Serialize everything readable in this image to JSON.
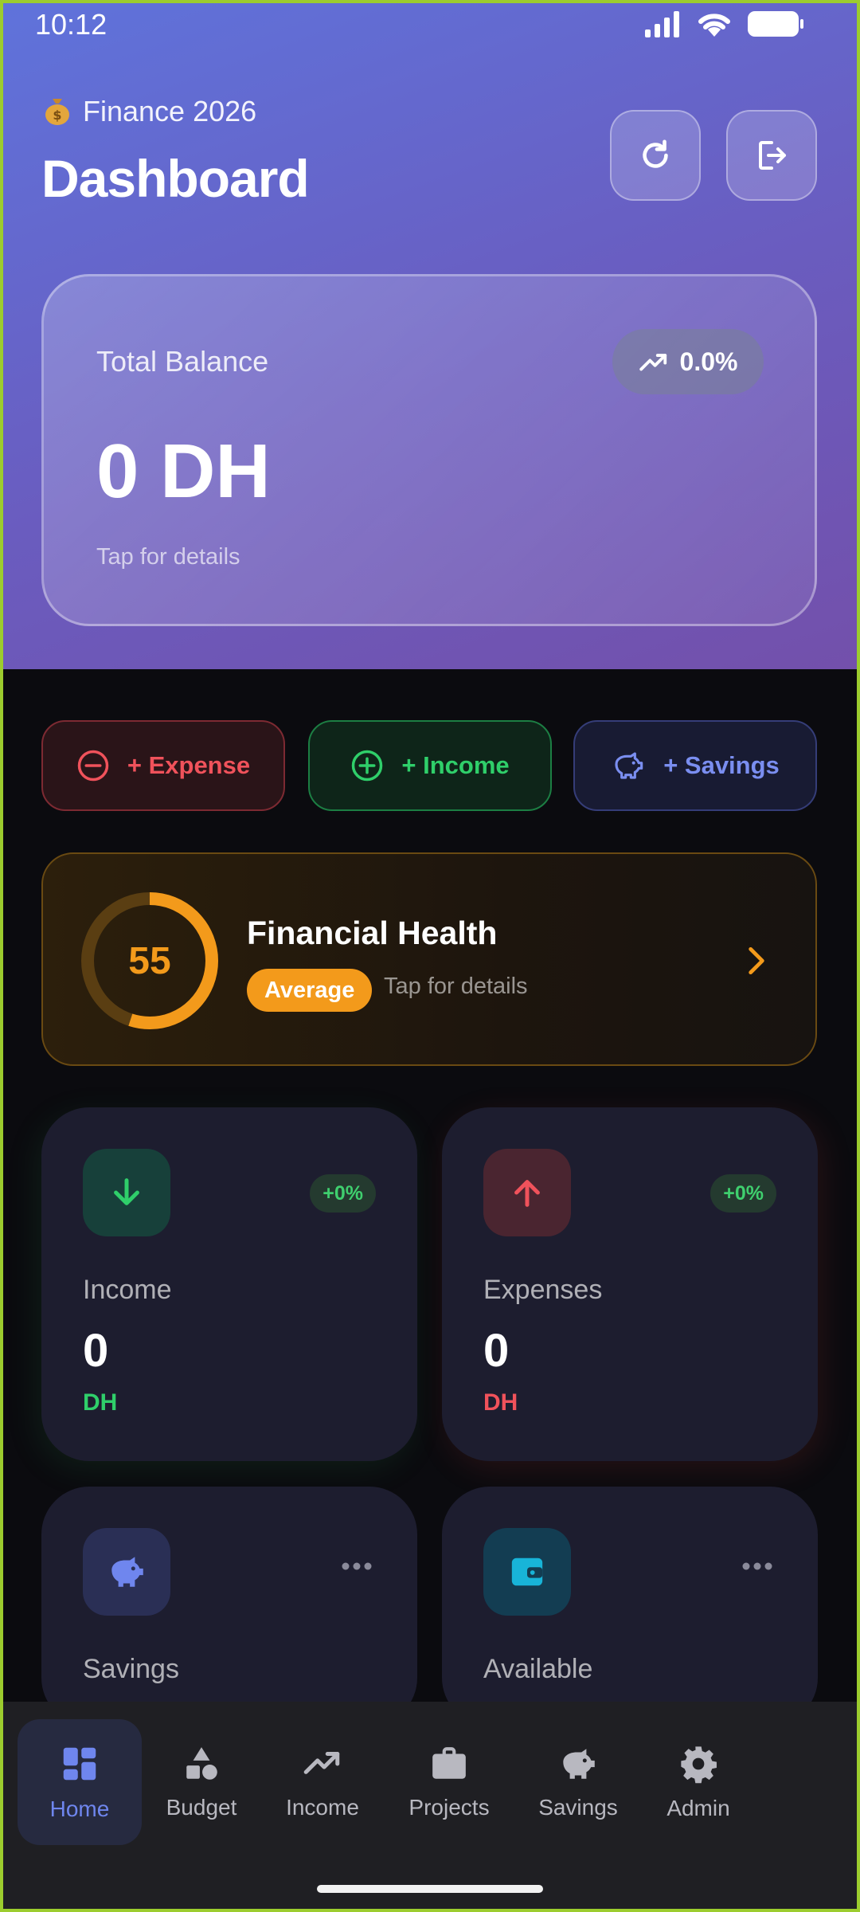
{
  "status_bar": {
    "time": "10:12"
  },
  "header": {
    "subtitle": "Finance 2026",
    "title": "Dashboard",
    "emoji_icon": "money-bag-icon"
  },
  "balance": {
    "label": "Total Balance",
    "trend": "0.0%",
    "amount": "0 DH",
    "hint": "Tap for details"
  },
  "quick_actions": {
    "expense": "+ Expense",
    "income": "+ Income",
    "savings": "+ Savings"
  },
  "health": {
    "score": "55",
    "score_fraction": 0.55,
    "title": "Financial Health",
    "badge": "Average",
    "hint": "Tap for details",
    "color": "#f39a1b"
  },
  "cards": {
    "income": {
      "label": "Income",
      "value": "0",
      "unit": "DH",
      "change": "+0%"
    },
    "expenses": {
      "label": "Expenses",
      "value": "0",
      "unit": "DH",
      "change": "+0%"
    },
    "savings": {
      "label": "Savings"
    },
    "available": {
      "label": "Available"
    }
  },
  "nav": [
    {
      "label": "Home",
      "icon": "dashboard-icon",
      "active": true
    },
    {
      "label": "Budget",
      "icon": "shapes-icon"
    },
    {
      "label": "Income",
      "icon": "trending-up-icon"
    },
    {
      "label": "Projects",
      "icon": "briefcase-icon"
    },
    {
      "label": "Savings",
      "icon": "piggy-bank-icon"
    },
    {
      "label": "Admin",
      "icon": "settings-icon"
    }
  ],
  "colors": {
    "accent": "#6f86ee",
    "income_green": "#2fcf6a",
    "expense_red": "#f0525b",
    "warning_orange": "#f39a1b"
  }
}
